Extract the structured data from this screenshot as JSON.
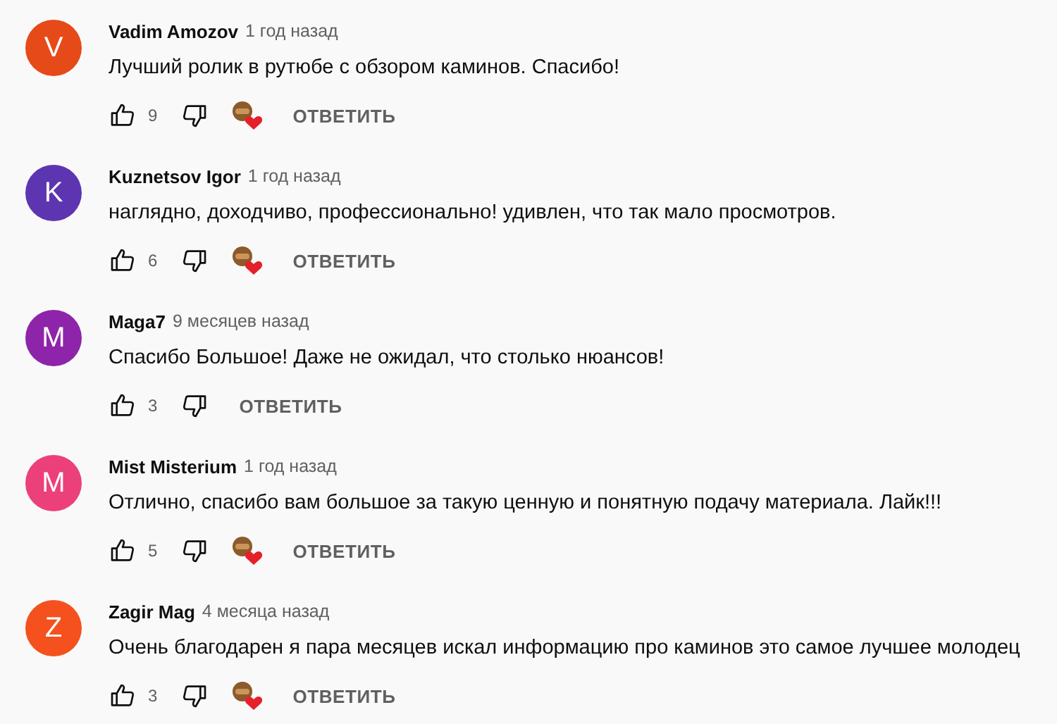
{
  "comments": [
    {
      "initial": "V",
      "color": "#e64a19",
      "author": "Vadim Amozov",
      "time": "1 год назад",
      "text": "Лучший ролик в рутюбе с обзором каминов. Спасибо!",
      "likes": "9",
      "hearted": true,
      "reply": "ОТВЕТИТЬ"
    },
    {
      "initial": "K",
      "color": "#5e35b1",
      "author": "Kuznetsov Igor",
      "time": "1 год назад",
      "text": "наглядно, доходчиво, профессионально! удивлен, что так мало просмотров.",
      "likes": "6",
      "hearted": true,
      "reply": "ОТВЕТИТЬ"
    },
    {
      "initial": "M",
      "color": "#8e24aa",
      "author": "Maga7",
      "time": "9 месяцев назад",
      "text": "Спасибо Большое! Даже не ожидал, что столько нюансов!",
      "likes": "3",
      "hearted": false,
      "reply": "ОТВЕТИТЬ"
    },
    {
      "initial": "M",
      "color": "#ec407a",
      "author": "Mist Misterium",
      "time": "1 год назад",
      "text": "Отлично, спасибо вам большое за такую ценную и понятную подачу материала. Лайк!!!",
      "likes": "5",
      "hearted": true,
      "reply": "ОТВЕТИТЬ"
    },
    {
      "initial": "Z",
      "color": "#f4511e",
      "author": "Zagir Mag",
      "time": "4 месяца назад",
      "text": "Очень благодарен я пара месяцев искал информацию про каминов это самое лучшее молодец",
      "likes": "3",
      "hearted": true,
      "reply": "ОТВЕТИТЬ"
    }
  ]
}
